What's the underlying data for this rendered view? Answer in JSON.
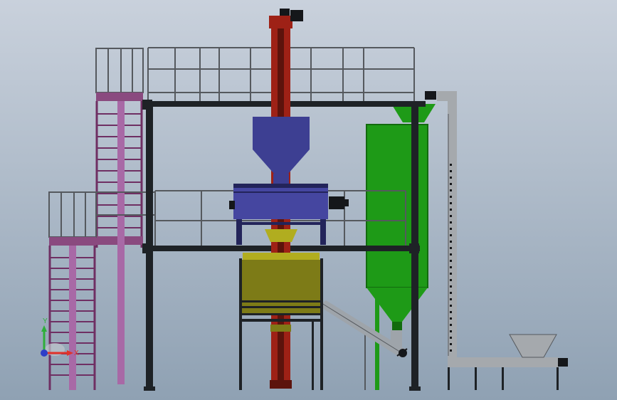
{
  "viewport": {
    "background_top": "#c9d1dc",
    "background_bottom": "#8fa1b3"
  },
  "colors": {
    "steel_frame": "#1e2226",
    "railing": "#55595e",
    "ladder_magenta": "#6f2f63",
    "ladder_post": "#a869a6",
    "platform_band": "#8a4a7f",
    "elevator_red": "#9e2116",
    "elevator_dark": "#5c130c",
    "hopper_blue": "#3d3f92",
    "mixer_blue": "#4546a0",
    "mixer_dark": "#23245a",
    "silo_green": "#1e9a17",
    "silo_dark": "#126b0e",
    "olive_hopper": "#7d7b17",
    "olive_light": "#b1ad1f",
    "screw_gray": "#9ea4aa",
    "conveyor_gray": "#a5a9ad",
    "motor_black": "#15171a"
  },
  "equipment": [
    "bucket-elevator",
    "top-feed-hopper",
    "ribbon-mixer",
    "finished-product-hopper",
    "storage-silo",
    "screw-conveyor",
    "z-type-conveyor",
    "feed-hopper"
  ],
  "triad": {
    "x_label": "X",
    "y_label": "Y",
    "x_color": "#e0332b",
    "y_color": "#2eae3a",
    "z_color": "#2d3ec8"
  }
}
